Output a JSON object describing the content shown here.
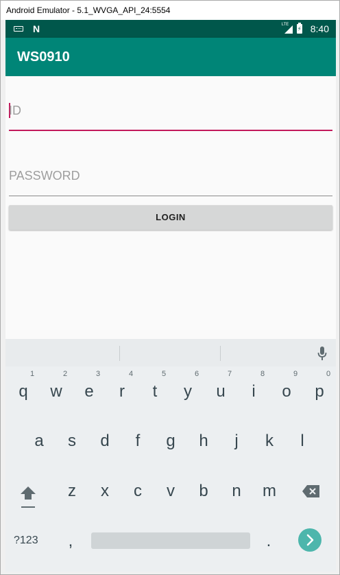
{
  "window": {
    "title": "Android Emulator - 5.1_WVGA_API_24:5554"
  },
  "status_bar": {
    "time": "8:40",
    "network": "LTE",
    "icons": [
      "keyboard-icon",
      "n-icon",
      "lte-signal-icon",
      "battery-icon"
    ]
  },
  "app_bar": {
    "title": "WS0910"
  },
  "form": {
    "id_hint": "ID",
    "password_hint": "PASSWORD",
    "login_label": "LOGIN"
  },
  "colors": {
    "status_bar": "#00574b",
    "app_bar": "#008577",
    "accent": "#c2185b",
    "enter_key": "#4db6ac"
  },
  "keyboard": {
    "row1": [
      {
        "key": "q",
        "num": "1"
      },
      {
        "key": "w",
        "num": "2"
      },
      {
        "key": "e",
        "num": "3"
      },
      {
        "key": "r",
        "num": "4"
      },
      {
        "key": "t",
        "num": "5"
      },
      {
        "key": "y",
        "num": "6"
      },
      {
        "key": "u",
        "num": "7"
      },
      {
        "key": "i",
        "num": "8"
      },
      {
        "key": "o",
        "num": "9"
      },
      {
        "key": "p",
        "num": "0"
      }
    ],
    "row2": [
      "a",
      "s",
      "d",
      "f",
      "g",
      "h",
      "j",
      "k",
      "l"
    ],
    "row3": [
      "z",
      "x",
      "c",
      "v",
      "b",
      "n",
      "m"
    ],
    "symbols_label": "?123",
    "comma": ",",
    "period": "."
  }
}
